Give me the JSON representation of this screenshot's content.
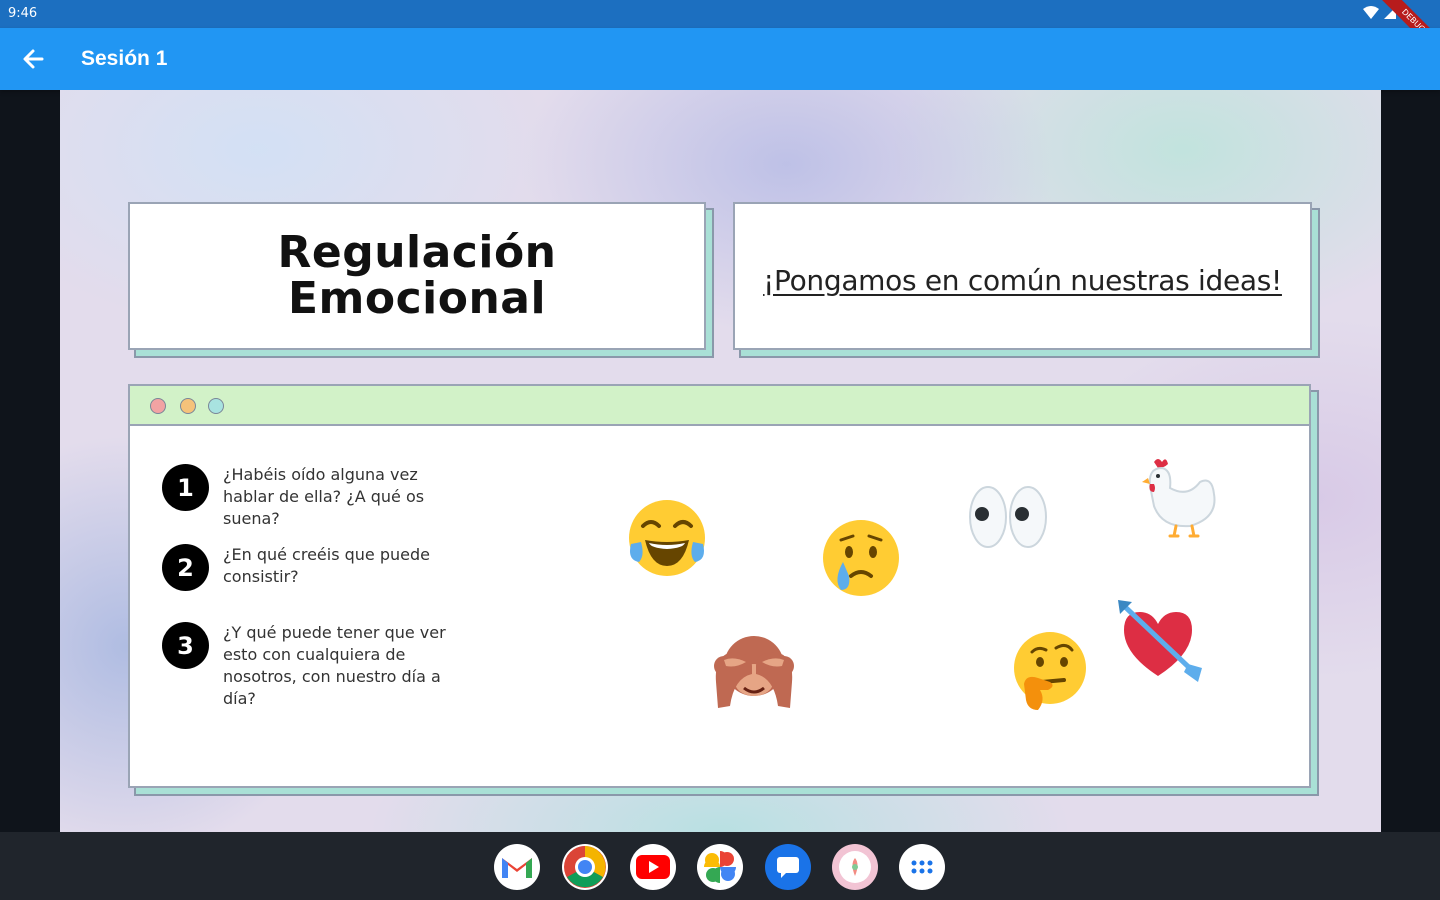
{
  "status_bar": {
    "time": "9:46",
    "debug_label": "DEBUG"
  },
  "app_bar": {
    "title": "Sesión 1"
  },
  "slide": {
    "title": "Regulación\nEmocional",
    "subtitle": "¡Pongamos en común nuestras ideas!",
    "questions": [
      {
        "number": "1",
        "text": "¿Habéis oído alguna vez hablar de ella? ¿A qué os suena?"
      },
      {
        "number": "2",
        "text": "¿En qué creéis que puede consistir?"
      },
      {
        "number": "3",
        "text": "¿Y qué puede tener que ver esto con cualquiera de nosotros, con nuestro día a día?"
      }
    ],
    "emojis": [
      "face-with-tears-of-joy",
      "crying-face",
      "eyes",
      "chicken",
      "see-no-evil-monkey",
      "thinking-face",
      "heart-with-arrow"
    ],
    "window_dot_colors": [
      "#f2a3a3",
      "#f5c27a",
      "#a8e3e0"
    ]
  },
  "dock": {
    "apps": [
      "gmail",
      "chrome",
      "youtube",
      "photos",
      "messages",
      "app",
      "app-launcher"
    ]
  }
}
